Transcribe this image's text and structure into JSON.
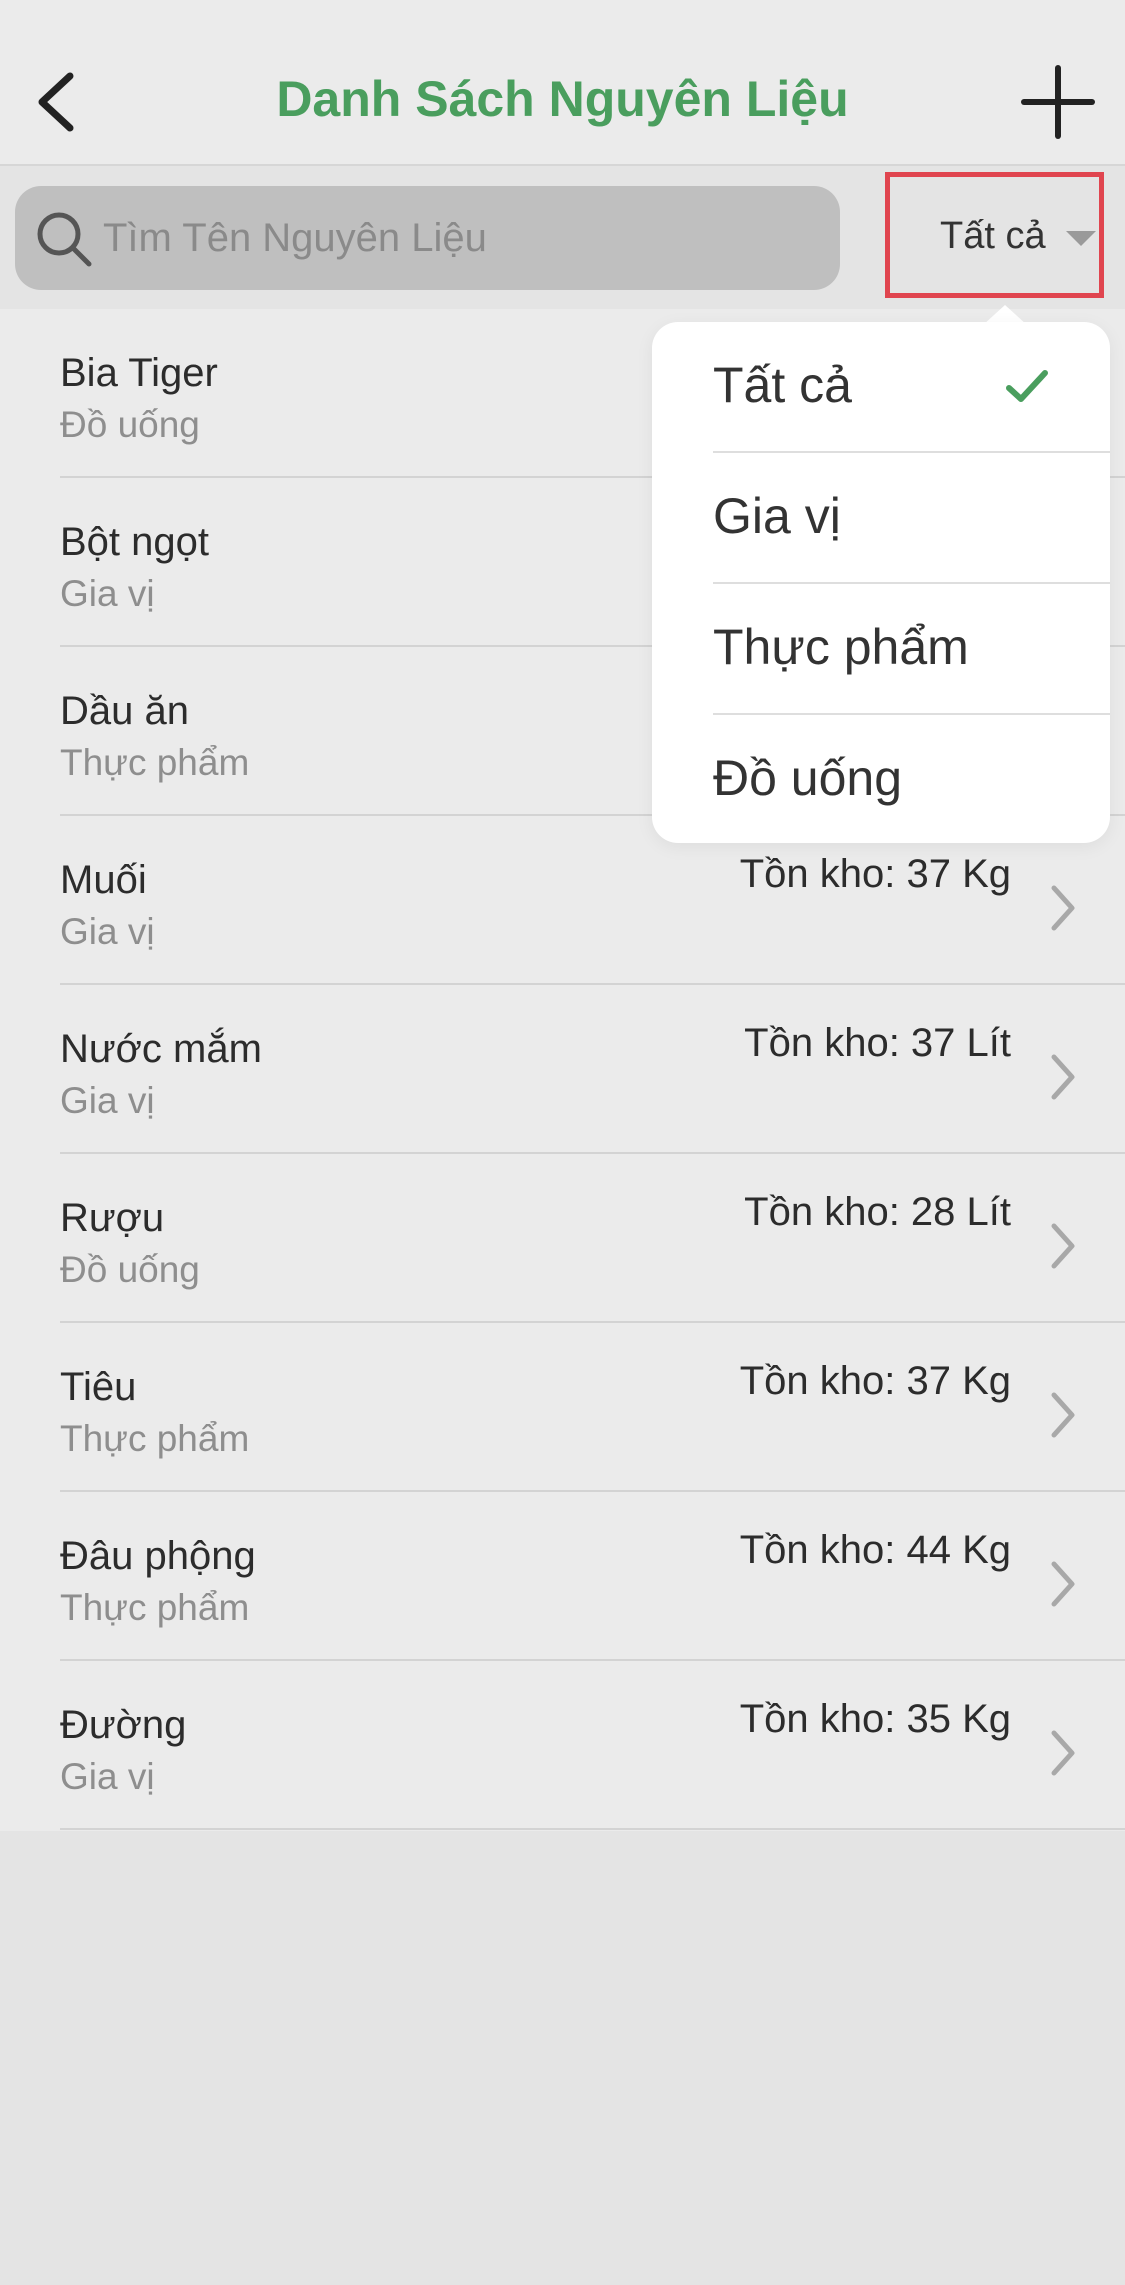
{
  "header": {
    "title": "Danh Sách Nguyên Liệu",
    "back_icon": "chevron-left-icon",
    "add_icon": "plus-icon"
  },
  "search": {
    "placeholder": "Tìm Tên Nguyên Liệu",
    "value": "",
    "icon": "search-icon"
  },
  "filter": {
    "selected": "Tất cả",
    "highlight_color": "#e0454f"
  },
  "colors": {
    "accent": "#4a9e5e",
    "check": "#4a9e5e"
  },
  "items": [
    {
      "name": "Bia Tiger",
      "category": "Đồ uống",
      "stock": ""
    },
    {
      "name": "Bột ngọt",
      "category": "Gia vị",
      "stock": ""
    },
    {
      "name": "Dầu ăn",
      "category": "Thực phẩm",
      "stock": ""
    },
    {
      "name": "Muối",
      "category": "Gia vị",
      "stock": "Tồn kho: 37 Kg"
    },
    {
      "name": "Nước mắm",
      "category": "Gia vị",
      "stock": "Tồn kho: 37 Lít"
    },
    {
      "name": "Rượu",
      "category": "Đồ uống",
      "stock": "Tồn kho: 28 Lít"
    },
    {
      "name": "Tiêu",
      "category": "Thực phẩm",
      "stock": "Tồn kho: 37 Kg"
    },
    {
      "name": "Đâu phộng",
      "category": "Thực phẩm",
      "stock": "Tồn kho: 44 Kg"
    },
    {
      "name": "Đường",
      "category": "Gia vị",
      "stock": "Tồn kho: 35 Kg"
    }
  ],
  "dropdown": {
    "options": [
      "Tất cả",
      "Gia vị",
      "Thực phẩm",
      "Đồ uống"
    ],
    "checked": "Tất cả"
  }
}
